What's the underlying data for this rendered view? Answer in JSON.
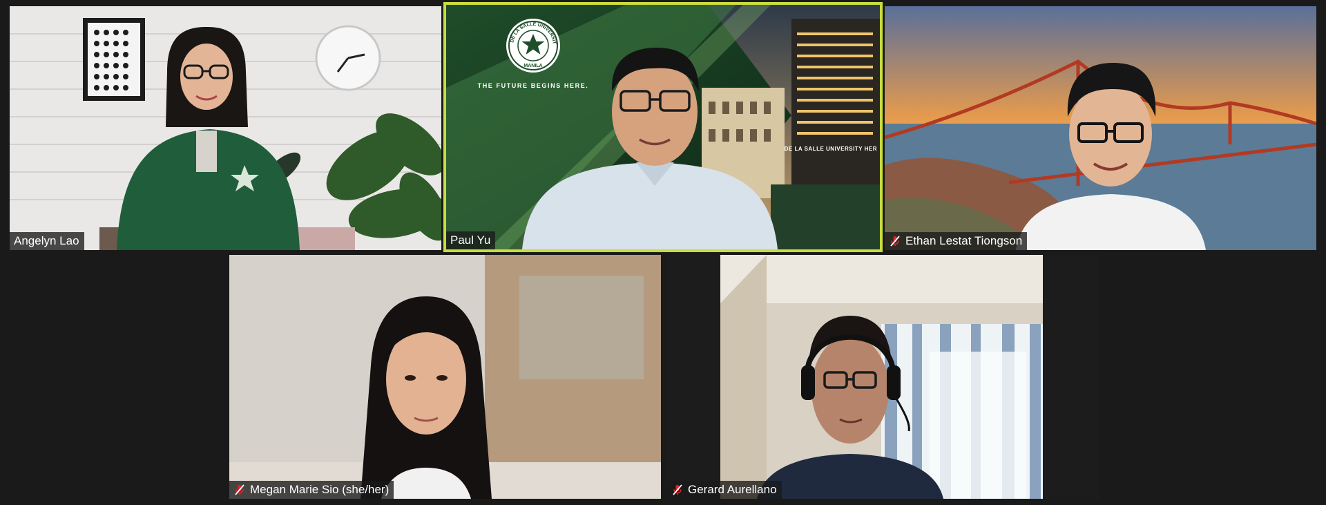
{
  "meeting": {
    "participants": [
      {
        "name": "Angelyn Lao",
        "muted": false
      },
      {
        "name": "Paul Yu",
        "muted": false,
        "active_speaker": true
      },
      {
        "name": "Ethan Lestat Tiongson",
        "muted": true
      },
      {
        "name": "Megan Marie Sio (she/her)",
        "muted": true
      },
      {
        "name": "Gerard Aurellano",
        "muted": true
      }
    ]
  },
  "virtual_background": {
    "tagline": "THE FUTURE BEGINS HERE.",
    "seal_text": "DE LA SALLE UNIVERSITY MANILA",
    "building_sign": "DE LA SALLE UNIVERSITY HER"
  },
  "colors": {
    "active_speaker_border": "#c9dd3c",
    "muted_icon": "#e0242b",
    "background": "#1a1a1a"
  },
  "icons": {
    "muted": "microphone-muted-icon"
  }
}
